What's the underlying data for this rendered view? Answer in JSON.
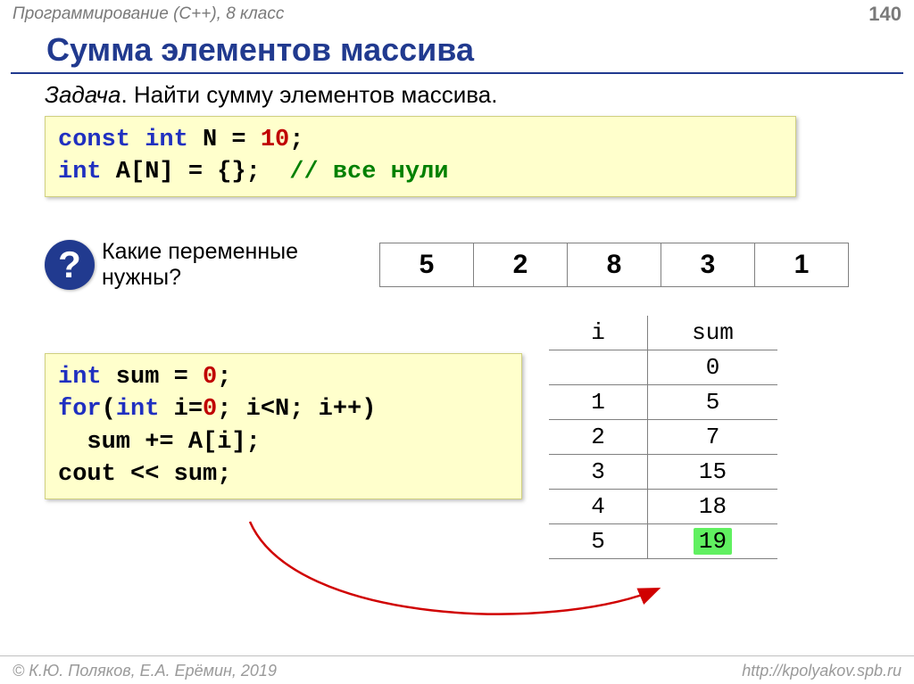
{
  "header": {
    "course": "Программирование (C++), 8 класс",
    "page": "140"
  },
  "title": "Сумма элементов массива",
  "task": {
    "label": "Задача",
    "text": ". Найти сумму элементов массива."
  },
  "code1": {
    "line1_kw": "const int",
    "line1_mid": " N = ",
    "line1_num": "10",
    "line1_end": ";",
    "line2_kw": "int",
    "line2_mid": " A[N] = {};  ",
    "line2_cmt": "// все нули"
  },
  "question": {
    "mark": "?",
    "text_l1": "Какие переменные",
    "text_l2": "нужны?"
  },
  "array_values": [
    "5",
    "2",
    "8",
    "3",
    "1"
  ],
  "trace": {
    "head_i": "i",
    "head_s": "sum",
    "rows": [
      {
        "i": "",
        "sum": "0"
      },
      {
        "i": "1",
        "sum": "5"
      },
      {
        "i": "2",
        "sum": "7"
      },
      {
        "i": "3",
        "sum": "15"
      },
      {
        "i": "4",
        "sum": "18"
      },
      {
        "i": "5",
        "sum": "19"
      }
    ]
  },
  "code2": {
    "l1_kw": "int",
    "l1_mid": " sum = ",
    "l1_num": "0",
    "l1_end": ";",
    "l2_kw1": "for",
    "l2_a": "(",
    "l2_kw2": "int",
    "l2_b": " i=",
    "l2_num": "0",
    "l2_c": "; i<N; i++)",
    "l3": "  sum += A[i];",
    "l4": "cout << sum;"
  },
  "footer": {
    "authors": "© К.Ю. Поляков, Е.А. Ерёмин, 2019",
    "url": "http://kpolyakov.spb.ru"
  }
}
